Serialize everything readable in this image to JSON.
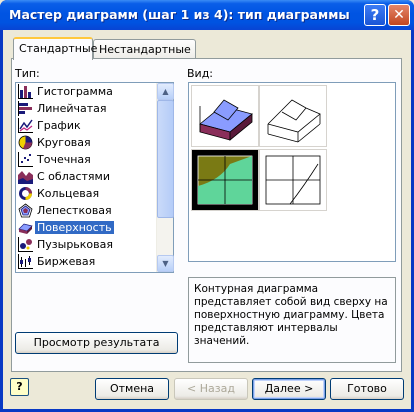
{
  "window": {
    "title": "Мастер диаграмм (шаг 1 из 4): тип диаграммы",
    "help_glyph": "?",
    "close_glyph": "✕"
  },
  "tabs": [
    {
      "label": "Стандартные",
      "active": true
    },
    {
      "label": "Нестандартные",
      "active": false
    }
  ],
  "type_label": "Тип:",
  "view_label": "Вид:",
  "chart_types": [
    {
      "label": "Гистограмма",
      "icon": "column-chart-icon"
    },
    {
      "label": "Линейчатая",
      "icon": "bar-chart-icon"
    },
    {
      "label": "График",
      "icon": "line-chart-icon"
    },
    {
      "label": "Круговая",
      "icon": "pie-chart-icon"
    },
    {
      "label": "Точечная",
      "icon": "scatter-chart-icon"
    },
    {
      "label": "С областями",
      "icon": "area-chart-icon"
    },
    {
      "label": "Кольцевая",
      "icon": "doughnut-chart-icon"
    },
    {
      "label": "Лепестковая",
      "icon": "radar-chart-icon"
    },
    {
      "label": "Поверхность",
      "icon": "surface-chart-icon",
      "selected": true
    },
    {
      "label": "Пузырьковая",
      "icon": "bubble-chart-icon"
    },
    {
      "label": "Биржевая",
      "icon": "stock-chart-icon"
    }
  ],
  "variant_selected": 3,
  "description": "Контурная диаграмма представляет собой вид сверху на поверхностную диаграмму. Цвета представляют интервалы значений.",
  "buttons": {
    "preview": "Просмотр результата",
    "help_icon": "?",
    "cancel": "Отмена",
    "back": "< Назад",
    "next": "Далее >",
    "finish": "Готово"
  },
  "colors": {
    "title_bar": "#0054e3",
    "selection": "#316ac5",
    "surface_blue": "#8a9cff",
    "surface_maroon": "#8a2e5a",
    "contour_olive": "#7a7a14",
    "contour_green": "#5fd59a"
  }
}
